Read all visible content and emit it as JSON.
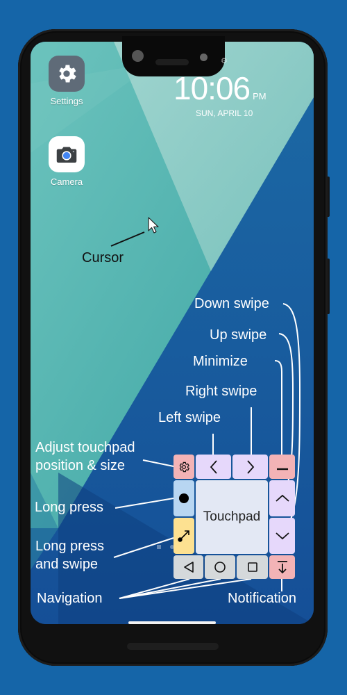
{
  "status_bar": {
    "time": "10:06",
    "ampm": "PM",
    "date": "SUN, APRIL 10",
    "status_icon": "gear-icon"
  },
  "home_screen": {
    "apps": [
      {
        "label": "Settings",
        "icon": "gear-icon"
      },
      {
        "label": "Camera",
        "icon": "camera-icon"
      }
    ],
    "page_indicator": {
      "pages": 2,
      "current": 1
    }
  },
  "touchpad": {
    "pad_label": "Touchpad",
    "buttons": {
      "settings": {
        "icon": "gear-icon",
        "color": "#f3b3b6"
      },
      "left_swipe": {
        "icon": "chevron-left-icon",
        "glyph": "<",
        "color": "#e6d8fb"
      },
      "right_swipe": {
        "icon": "chevron-right-icon",
        "glyph": ">",
        "color": "#e6d8fb"
      },
      "minimize": {
        "icon": "minus-icon",
        "color": "#f3b3b6"
      },
      "long_press": {
        "icon": "dot-icon",
        "color": "#b8d6f2"
      },
      "long_press_swipe": {
        "icon": "drag-arrow-icon",
        "color": "#fde191"
      },
      "up_swipe": {
        "icon": "chevron-up-icon",
        "color": "#e6d8fb"
      },
      "down_swipe": {
        "icon": "chevron-down-icon",
        "color": "#e6d8fb"
      },
      "back": {
        "icon": "triangle-back-icon",
        "color": "#d5d9db"
      },
      "home": {
        "icon": "circle-home-icon",
        "color": "#d5d9db"
      },
      "recents": {
        "icon": "square-recents-icon",
        "color": "#d5d9db"
      },
      "notification": {
        "icon": "arrow-down-bar-icon",
        "color": "#f3b3b6"
      }
    }
  },
  "annotations": {
    "cursor": "Cursor",
    "down_swipe": "Down swipe",
    "up_swipe": "Up swipe",
    "minimize": "Minimize",
    "right_swipe": "Right swipe",
    "left_swipe": "Left swipe",
    "adjust_line1": "Adjust touchpad",
    "adjust_line2": "position & size",
    "long_press": "Long press",
    "long_press_swipe_line1": "Long press",
    "long_press_swipe_line2": "and swipe",
    "navigation": "Navigation",
    "notification": "Notification"
  },
  "colors": {
    "background": "#1565a8",
    "wallpaper_teal": "#5bb8b4",
    "wallpaper_blue": "#1a56a0"
  }
}
